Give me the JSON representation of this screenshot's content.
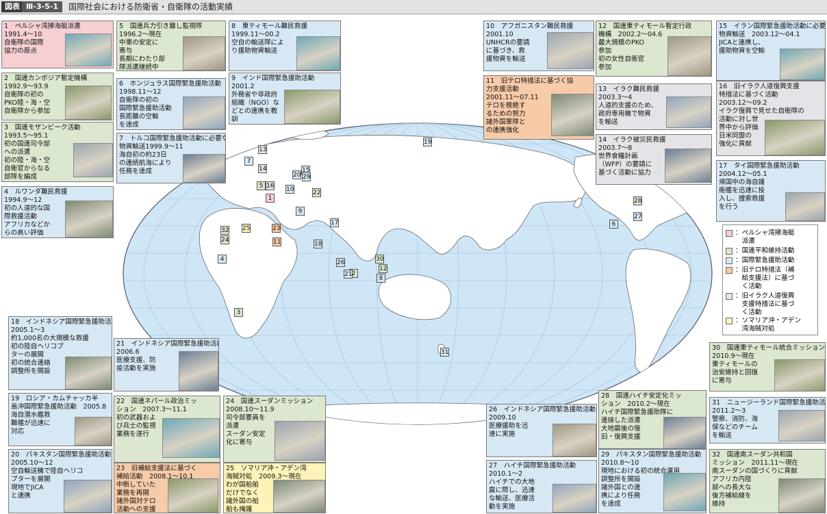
{
  "header": {
    "badge": "図表",
    "figure_id": "Ⅲ-3-5-1",
    "title": "国際社会における防衛省・自衛隊の活動実績"
  },
  "colors": {
    "pink": "#f6cfd2",
    "green": "#dbe8cf",
    "blue": "#d7e8f5",
    "orange": "#f7cba8",
    "gray": "#e4e4e8",
    "yellow": "#fbf3b8",
    "ocean": "#cfe6f7",
    "land": "#ffffff"
  },
  "legend": [
    {
      "color": "pink",
      "label": "：ペルシャ湾掃海艇\n　派遣"
    },
    {
      "color": "green",
      "label": "：国連平和維持活動"
    },
    {
      "color": "blue",
      "label": "：国際緊急援助活動"
    },
    {
      "color": "orange",
      "label": "：旧テロ特措法（補\n　給支援法）に基づ\n　く活動"
    },
    {
      "color": "gray",
      "label": "：旧イラク人道復興\n　支援特措法に基づ\n　く活動"
    },
    {
      "color": "yellow",
      "label": "：ソマリア沖・アデン\n　湾海賊対処"
    }
  ],
  "cards": [
    {
      "id": "1",
      "title": "1　ペルシャ湾掃海艇派遣",
      "body": "1991.4～10\n自衛隊の国際\n協力の原点",
      "photo": "minesweeper-photo"
    },
    {
      "id": "2",
      "title": "2　国連カンボジア暫定機構",
      "body": "1992.9～93.9\n自衛隊の初の\nPKO陸・海・空\n自衛隊から参加",
      "photo": "cambodia-photo"
    },
    {
      "id": "3",
      "title": "3　国連モザンビーク活動",
      "body": "1993.5～95.1\n初の国連司令部\nへの派遣\n初の陸・海・空\n自衛官からなる\n部隊を編成",
      "photo": "mozambique-photo"
    },
    {
      "id": "4",
      "title": "4　ルワンダ難民救援",
      "body": "1994.9～12\n初の人道的な国\n際救援活動\nアフリカなどか\nらの高い評価",
      "photo": "rwanda-photo"
    },
    {
      "id": "5",
      "title": "5　国連兵力引き離し監視隊",
      "body": "1996.2～現在\n中東の安定に\n寄与\n長期にわたり部\n隊派遣継続中",
      "photo": "golan-photo"
    },
    {
      "id": "6",
      "title": "6　ホンジュラス国際緊急援助活動",
      "body": "1998.11～12\n自衛隊の初の\n国際緊急援助活動\n長距離の空輸\nを達成",
      "photo": "honduras-photo"
    },
    {
      "id": "7",
      "title": "7　トルコ国際緊急援助活動に必要な\n物資輸送1999.9～11",
      "body": "海自初の約23日\nの連続航海により\n任務を達成",
      "photo": "turkey-photo"
    },
    {
      "id": "8",
      "title": "8　東ティモール難民救援",
      "body": "1999.11～00.2\n空自の輸送隊によ\nり援助物資輸送",
      "photo": "timor-refugee-photo"
    },
    {
      "id": "9",
      "title": "9　インド国際緊急援助活動",
      "body": "2001.2\n外務省や非政府\n組織（NGO）な\nどとの連携を教\n訓",
      "photo": "india-photo"
    },
    {
      "id": "10",
      "title": "10　アフガニスタン難民救援",
      "body": "2001.10\nUNHCRの要請\nに基づき、救\n援物資を輸送",
      "photo": "afghan-photo"
    },
    {
      "id": "11",
      "title": "11　旧テロ特措法に基づく協\n力支援活動",
      "body": "2001.11～07.11\nテロを根絶す\nるための努力\n諸外国軍隊と\nの連携強化",
      "photo": "refuel-photo"
    },
    {
      "id": "12",
      "title": "12　国連東ティモール暫定行政\n機構　2002.2～04.6",
      "body": "最大規模のPKO\n参加\n初の女性自衛官\n参加",
      "photo": "untaet-photo"
    },
    {
      "id": "13",
      "title": "13　イラク難民救援",
      "body": "2003.3～4\n人道的支援のため、\n政府専用機で物資\nを輸送",
      "photo": "iraq-refugee-photo"
    },
    {
      "id": "14",
      "title": "14　イラク被災民救援",
      "body": "2003.7～8\n世界食糧計画\n（WFP）の要請に\n基づく活動に協力",
      "photo": "wfp-photo"
    },
    {
      "id": "15",
      "title": "15　イラン国際緊急援助活動に必要な\n物資輸送　2003.12～04.1",
      "body": "JICAと連携し、\n援助物資を空輸",
      "photo": "iran-photo"
    },
    {
      "id": "16",
      "title": "16　旧イラク人道復興支援\n特措法に基づく活動",
      "body": "2003.12～09.2\nイラク復興で見せた自衛隊の\n活動に対し世\n界中から評価\n日米同盟の\n強化に貢献",
      "photo": "iraq-children-photo"
    },
    {
      "id": "17",
      "title": "17　タイ国際緊急援助活動",
      "body": "2004.12～05.1\n帰国中の海自護\n衛艦を迅速に投\n入し、捜索救援\nを行う",
      "photo": "thailand-photo"
    },
    {
      "id": "18",
      "title": "18　インドネシア国際緊急援助活動",
      "body": "2005.1～3\n約1,000名の大規模な救援\n初の陸自ヘリコプ\nターの展開\n初の統合連絡\n調整所を開設",
      "photo": "aceh-photo"
    },
    {
      "id": "19",
      "title": "19　ロシア・カムチャッカ半\n島沖国際緊急援助活動　2005.8",
      "body": "海自潜水艦救\n難艦が迅速に\n対応",
      "photo": "kamchatka-photo"
    },
    {
      "id": "20",
      "title": "20　パキスタン国際緊急援助活動",
      "body": "2005.10～12\n空自輸送機で陸自ヘリコ\nプターを展開\n現地でJICA\nと連携",
      "photo": "pakistan-heli-photo"
    },
    {
      "id": "21",
      "title": "21　インドネシア国際緊急援助活動",
      "body": "2006.6\n医療支援、防\n疫活動を実施",
      "photo": "java-photo"
    },
    {
      "id": "22",
      "title": "22　国連ネパール政治ミッ\nション　2007.3～11.1",
      "body": "初の武器およ\nび兵士の監視\n業務を遂行",
      "photo": "nepal-photo"
    },
    {
      "id": "23",
      "title": "23　旧補給支援法に基づく\n補給活動　2008.1～10.1",
      "body": "中断していた\n業務を再開\n諸外国対テロ\n活動への支援",
      "photo": "supply-ship-photo"
    },
    {
      "id": "24",
      "title": "24　国連スーダンミッション",
      "body": "2008.10～11.9\n司令部要員を\n派遣\nスーダン安定\n化に寄与",
      "photo": "sudan-photo"
    },
    {
      "id": "25",
      "title": "25　ソマリア沖・アデン湾\n海賊対処　2009.3～現在",
      "body": "わが国船舶\nだけでなく\n諸外国の船\n舶も掩護",
      "photo": "escort-photo"
    },
    {
      "id": "26",
      "title": "26　インドネシア国際緊急援助活動",
      "body": "2009.10\n医療援助を迅\n速に実施",
      "photo": "sumatra-photo"
    },
    {
      "id": "27",
      "title": "27　ハイチ国際緊急援助活動",
      "body": "2010.1～2\nハイチでの大地\n震に際し、迅速\nな輸送、医療活\n動を実施",
      "photo": "haiti-medical-photo"
    },
    {
      "id": "28",
      "title": "28　国連ハイチ安定化ミッ\nション　2010.2～現在",
      "body": "ハイチ国際緊急援助隊に\n連接した派遣\n大地震後の復\n旧・復興支援",
      "photo": "minustah-photo"
    },
    {
      "id": "29",
      "title": "29　パキスタン国際緊急援助活動",
      "body": "2010.8～10\n現地における初の統合運用\n調整所を開設\n諸外国との連\n携により任務\nを達成",
      "photo": "pakistan-flood-photo"
    },
    {
      "id": "30",
      "title": "30　国連東ティモール統合ミッション",
      "body": "2010.9～現在\n東ティモールの\n治安維持と回復\nに寄与",
      "photo": "unmit-photo"
    },
    {
      "id": "31",
      "title": "31　ニュージーランド国際緊急援助活動",
      "body": "2011.2～3\n警察、消防、海\n保などのチーム\nを輸送",
      "photo": "nz-photo"
    },
    {
      "id": "32",
      "title": "32　国連南スーダン共和国\nミッション　2011.11～現在",
      "body": "南スーダンの国づくりに貢献\nアフリカ内陸\n部への長大な\n後方補給線を\n維持",
      "photo": "south-sudan-photo"
    }
  ]
}
